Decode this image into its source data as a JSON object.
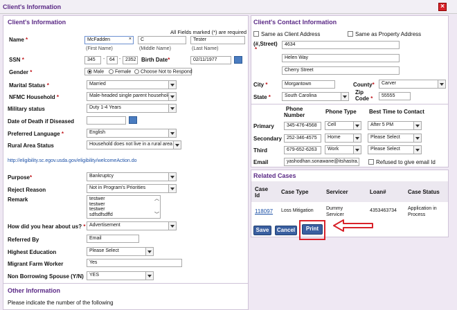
{
  "window": {
    "title": "Client's Information",
    "close_glyph": "×"
  },
  "client": {
    "section_title": "Client's Information",
    "required_note": "All Fields marked (*) are required",
    "name_label": "Name",
    "first_name": "McFadden",
    "middle_name": "C",
    "last_name": "Tester",
    "first_caption": "(First Name)",
    "middle_caption": "(Middle Name)",
    "last_caption": "(Last Name)",
    "ssn_label": "SSN",
    "ssn1": "345",
    "ssn2": "64",
    "ssn3": "2352",
    "dash": "-",
    "birth_label": "Birth Date",
    "birth_date": "02/11/1977",
    "gender_label": "Gender",
    "gender_options": [
      "Male",
      "Female",
      "Choose Not to Respond"
    ],
    "gender_selected": "Male",
    "marital_label": "Marital Status",
    "marital_value": "Married",
    "nfmc_label": "NFMC Household",
    "nfmc_value": "Male-headed single parent household",
    "military_label": "Military status",
    "military_value": "Duty 1-4 Years",
    "death_label": "Date of Death if Diseased",
    "death_value": "",
    "language_label": "Preferred Language",
    "language_value": "English",
    "rural_label": "Rural Area Status",
    "rural_value": "Household does not live in a rural area",
    "eligibility_link": "http://eligibility.sc.egov.usda.gov/eligibility/welcomeAction.do",
    "purpose_label": "Purpose",
    "purpose_value": "Bankruptcy",
    "reject_label": "Reject Reason",
    "reject_value": "Not in Program's Priorities",
    "remark_label": "Remark",
    "remark_lines": [
      "testwer",
      "testwer",
      "testwer",
      "sdfsdfsdffd"
    ],
    "hear_label": "How did you hear about us?",
    "hear_value": "Advertisement",
    "referred_label": "Referred By",
    "referred_value": "Email",
    "education_label": "Highest Education",
    "education_value": "Please Select",
    "migrant_label": "Migrant Farm Worker",
    "migrant_value": "Yes",
    "nonborrow_label": "Non Borrowing Spouse (Y/N)",
    "nonborrow_value": "YES"
  },
  "other": {
    "section_title": "Other Information",
    "prompt": "Please indicate the number of the following"
  },
  "contact": {
    "section_title": "Client's Contact Information",
    "same_client": "Same as Client Address",
    "same_property": "Same as Property Address",
    "street_label": "(#,Street)",
    "address1": "4634",
    "address2": "Helen Way",
    "address3": "Cherry Street",
    "city_label": "City",
    "city_value": "Morgantown",
    "county_label": "County",
    "county_value": "Carver",
    "state_label": "State",
    "state_value": "South Carolina",
    "zip_label_1": "Zip",
    "zip_label_2": "Code",
    "zip_value": "55555",
    "phone_headers": [
      "Phone",
      "Number",
      "Phone Type",
      "Best Time to Contact"
    ],
    "phones": [
      {
        "label": "Primary",
        "number": "345-476-4568",
        "type": "Cell",
        "time": "After 5 PM"
      },
      {
        "label": "Secondary",
        "number": "252-346-4575",
        "type": "Home",
        "time": "Please Select"
      },
      {
        "label": "Third",
        "number": "679-652-6263",
        "type": "Work",
        "time": "Please Select"
      }
    ],
    "email_label": "Email",
    "email_value": "yashodhan.sonawane@itshastra.c",
    "refused_email": "Refused to give email Id"
  },
  "related": {
    "section_title": "Related Cases",
    "headers": [
      "Case",
      "Id",
      "Case Type",
      "Servicer",
      "Loan#",
      "Case Status"
    ],
    "row": {
      "case_id": "118097",
      "case_type": "Loss Mitigation",
      "servicer_1": "Dummy",
      "servicer_2": "Servicer",
      "loan": "4353463734",
      "status_1": "Application in",
      "status_2": "Process"
    }
  },
  "actions": {
    "save": "Save",
    "cancel": "Cancel",
    "print": "Print"
  },
  "colors": {
    "accent": "#5b2a86",
    "button": "#3a5fa0",
    "annotation": "#d8222a"
  }
}
